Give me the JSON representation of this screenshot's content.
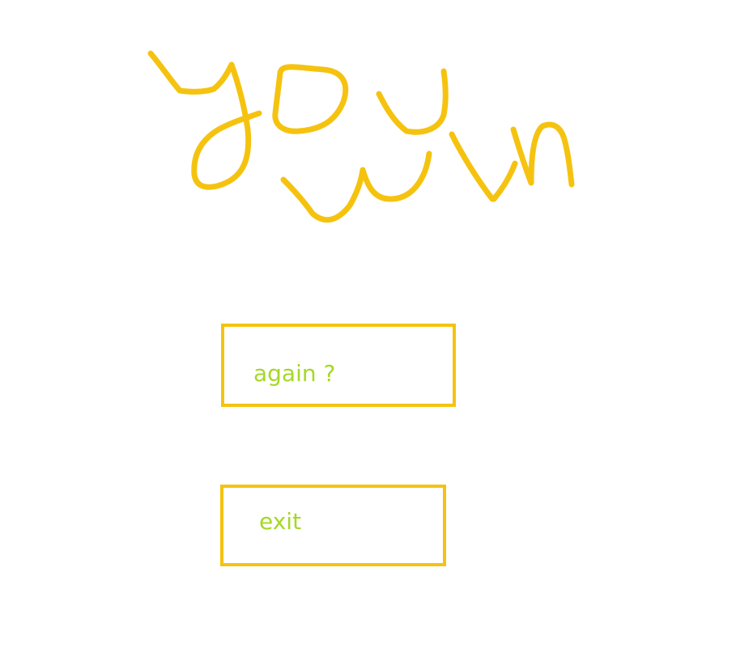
{
  "theme": {
    "accent": "#f5c30f",
    "text": "#a6d826",
    "background": "#ffffff"
  },
  "title_art": {
    "text": "you win",
    "style": "handwritten"
  },
  "menu": {
    "again_label": "again ?",
    "exit_label": "exit"
  }
}
